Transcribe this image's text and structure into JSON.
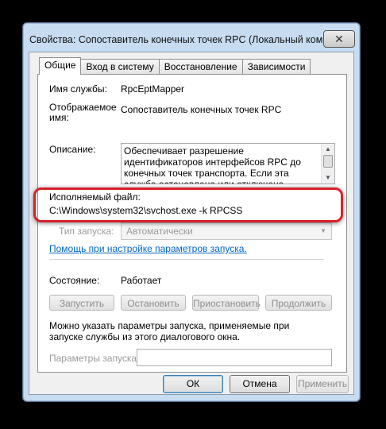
{
  "window": {
    "title": "Свойства: Сопоставитель конечных точек RPC (Локальный ком...",
    "close_glyph": "✕"
  },
  "tabs": [
    {
      "label": "Общие",
      "active": true
    },
    {
      "label": "Вход в систему",
      "active": false
    },
    {
      "label": "Восстановление",
      "active": false
    },
    {
      "label": "Зависимости",
      "active": false
    }
  ],
  "general": {
    "service_name_label": "Имя службы:",
    "service_name_value": "RpcEptMapper",
    "display_name_label": "Отображаемое имя:",
    "display_name_value": "Сопоставитель конечных точек RPC",
    "description_label": "Описание:",
    "description_value": "Обеспечивает разрешение идентификаторов интерфейсов RPC до конечных точек транспорта. Если эта служба остановлена или отключена, программы, использующие службы",
    "exe_label": "Исполняемый файл:",
    "exe_value": "C:\\Windows\\system32\\svchost.exe -k RPCSS",
    "startup_type_label": "Тип запуска:",
    "startup_type_value": "Автоматически",
    "help_link": "Помощь при настройке параметров запуска.",
    "status_label": "Состояние:",
    "status_value": "Работает",
    "btn_start": "Запустить",
    "btn_stop": "Остановить",
    "btn_pause": "Приостановить",
    "btn_resume": "Продолжить",
    "params_note": "Можно указать параметры запуска, применяемые при запуске службы из этого диалогового окна.",
    "params_label": "Параметры запуска:",
    "params_value": ""
  },
  "footer": {
    "ok": "ОК",
    "cancel": "Отмена",
    "apply": "Применить"
  },
  "colors": {
    "highlight": "#d5222a",
    "link": "#0066cc"
  }
}
